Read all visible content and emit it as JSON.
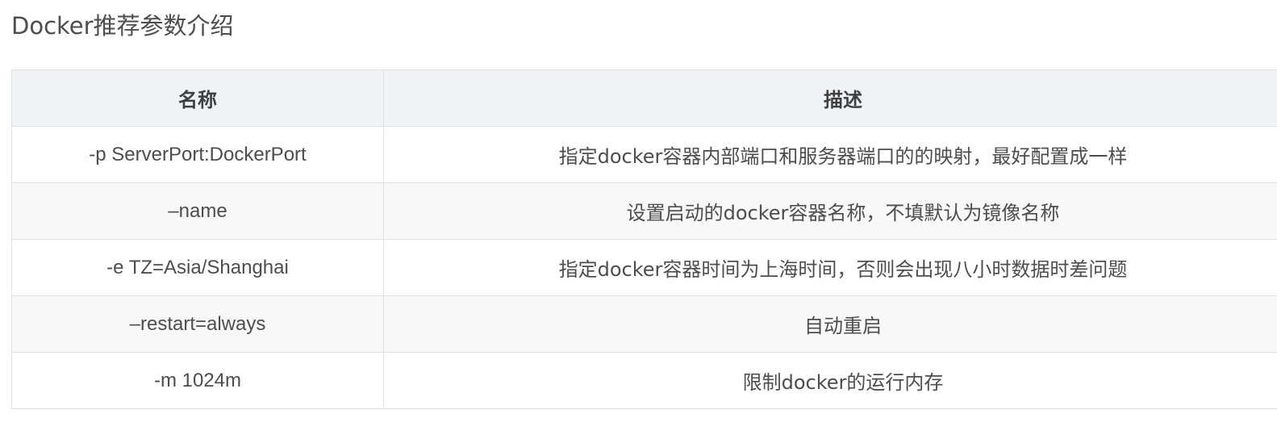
{
  "heading": "Docker推荐参数介绍",
  "table": {
    "headers": {
      "name": "名称",
      "description": "描述"
    },
    "rows": [
      {
        "name": "-p ServerPort:DockerPort",
        "description": "指定docker容器内部端口和服务器端口的的映射，最好配置成一样"
      },
      {
        "name": "–name",
        "description": "设置启动的docker容器名称，不填默认为镜像名称"
      },
      {
        "name": "-e TZ=Asia/Shanghai",
        "description": "指定docker容器时间为上海时间，否则会出现八小时数据时差问题"
      },
      {
        "name": "–restart=always",
        "description": "自动重启"
      },
      {
        "name": "-m 1024m",
        "description": "限制docker的运行内存"
      }
    ]
  }
}
